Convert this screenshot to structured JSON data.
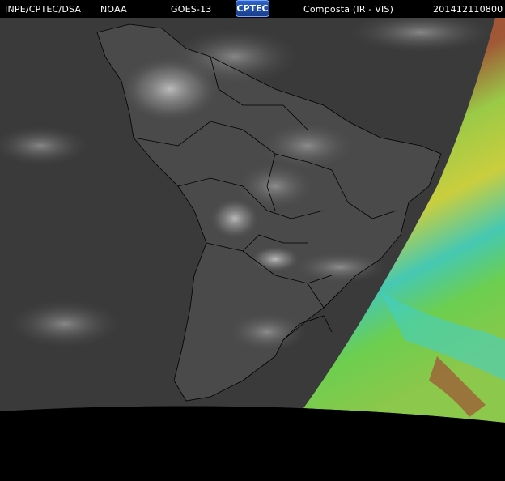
{
  "header": {
    "source_left": "INPE/CPTEC/DSA",
    "agency": "NOAA",
    "satellite": "GOES-13",
    "logo_text": "CPTEC",
    "product": "Composta (IR - VIS)",
    "timestamp": "201412110800"
  },
  "colors": {
    "background": "#000000",
    "ir_ocean": "#3b3b3b",
    "ir_land": "#444444",
    "vis_red": "#b24a34",
    "vis_green": "#6fd64a",
    "vis_yellow": "#c9d43b",
    "vis_cyan": "#39d3d6",
    "border_lines": "#000000"
  }
}
